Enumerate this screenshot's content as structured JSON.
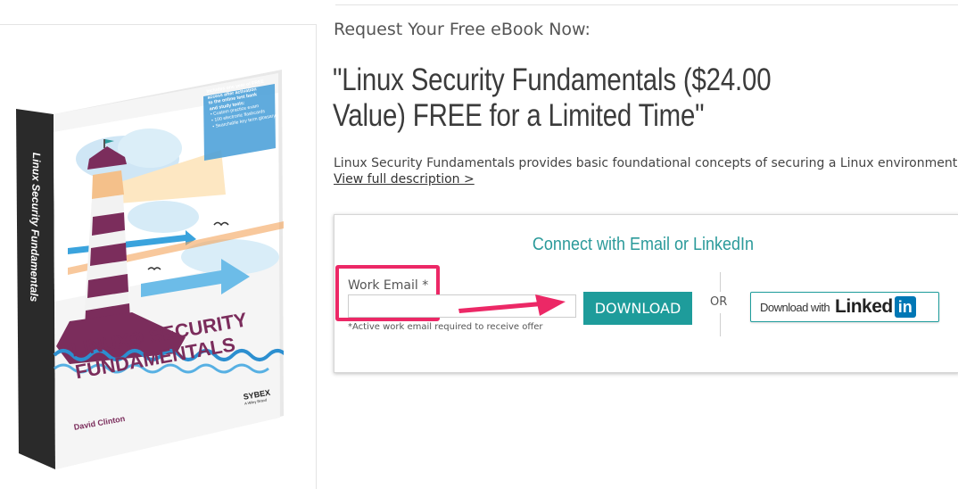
{
  "page": {
    "request_label": "Request Your Free eBook Now:",
    "offer_title": "\"Linux Security Fundamentals ($24.00 Value) FREE for a Limited Time\"",
    "description": "Linux Security Fundamentals provides basic foundational concepts of securing a Linux environment.",
    "description_link": "View full description >"
  },
  "book_cover": {
    "spine_title": "Linux Security Fundamentals",
    "title_line1": "LINUX® SECURITY",
    "title_line2": "FUNDAMENTALS",
    "author": "David Clinton",
    "publisher": "SYBEX",
    "publisher_sub": "A Wiley Brand",
    "callout_lines": [
      "Includes one year of FREE",
      "access after activation",
      "to the online test bank",
      "and study tools:",
      "• Custom practice exam",
      "• 100 electronic flashcards",
      "• Searchable key term glossary"
    ]
  },
  "form": {
    "heading": "Connect with Email or LinkedIn",
    "email_label": "Work Email *",
    "email_value": "",
    "email_placeholder": "",
    "note": "*Active work email required to receive offer",
    "download_label": "DOWNLOAD",
    "or_label": "OR",
    "linkedin_prefix": "Download with",
    "linkedin_word": "Linked",
    "linkedin_in": "in"
  },
  "colors": {
    "accent_teal": "#1e9c9b",
    "highlight_pink": "#ec2866",
    "linkedin_blue": "#0077b5",
    "cover_purple": "#7b2d5c"
  }
}
